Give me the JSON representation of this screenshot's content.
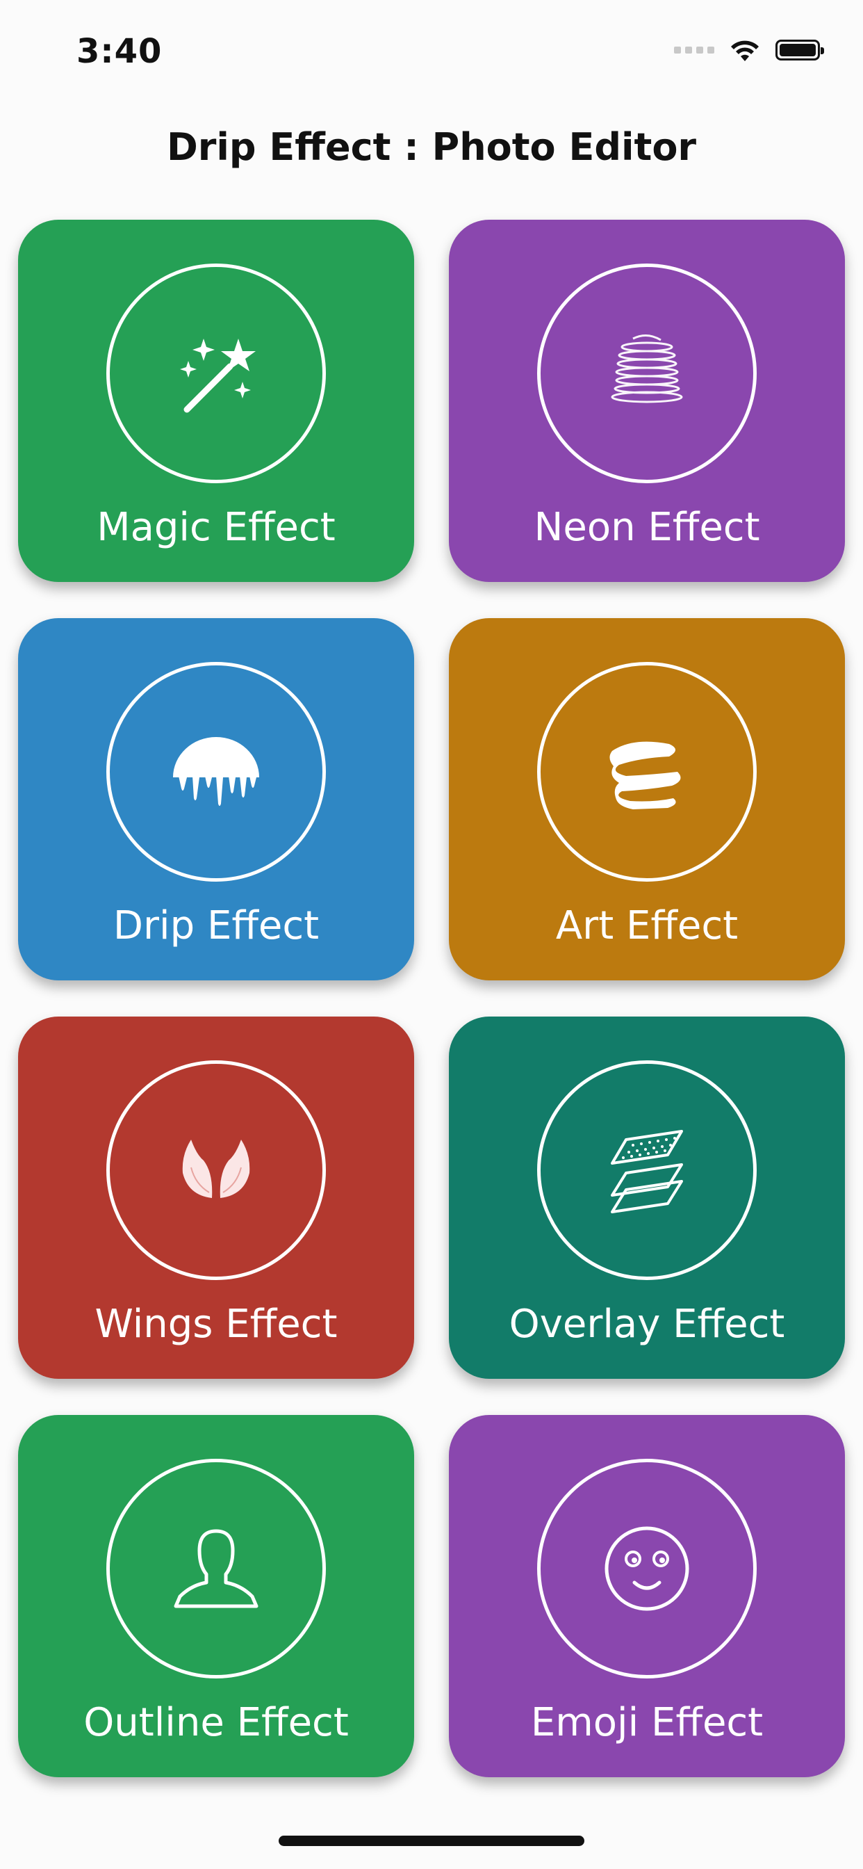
{
  "status_bar": {
    "time": "3:40"
  },
  "header": {
    "title": "Drip Effect  : Photo Editor"
  },
  "cards": [
    {
      "label": "Magic Effect",
      "color": "#25a055",
      "icon": "magic-wand-icon"
    },
    {
      "label": "Neon Effect",
      "color": "#8a47ae",
      "icon": "neon-spiral-icon"
    },
    {
      "label": "Drip Effect",
      "color": "#2f87c4",
      "icon": "drip-icon"
    },
    {
      "label": "Art Effect",
      "color": "#bc7a0f",
      "icon": "paint-scribble-icon"
    },
    {
      "label": "Wings Effect",
      "color": "#b3392f",
      "icon": "wings-icon"
    },
    {
      "label": "Overlay Effect",
      "color": "#127c69",
      "icon": "layers-icon"
    },
    {
      "label": "Outline Effect",
      "color": "#25a055",
      "icon": "person-outline-icon"
    },
    {
      "label": "Emoji Effect",
      "color": "#8a47ae",
      "icon": "emoji-icon"
    }
  ]
}
